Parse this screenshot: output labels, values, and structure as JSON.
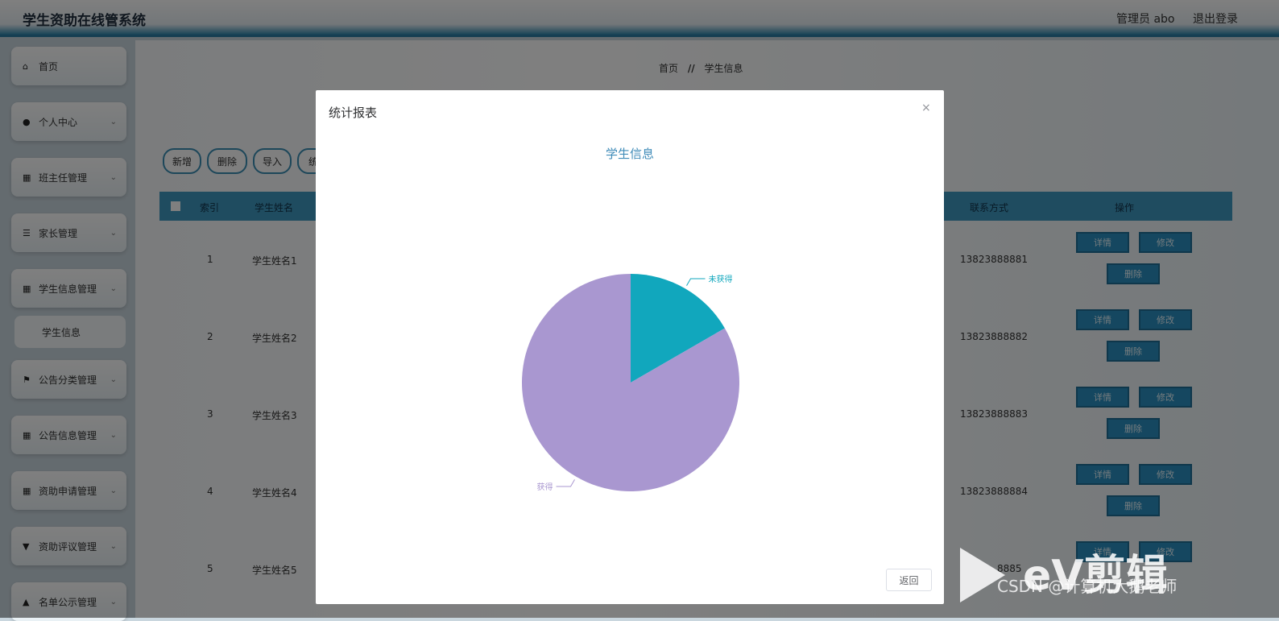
{
  "app": {
    "title": "学生资助在线管系统",
    "admin_label": "管理员 abo",
    "logout_label": "退出登录"
  },
  "sidebar": {
    "items": [
      {
        "label": "首页",
        "icon": "home-icon"
      },
      {
        "label": "个人中心",
        "icon": "user-icon"
      },
      {
        "label": "班主任管理",
        "icon": "grid-icon"
      },
      {
        "label": "家长管理",
        "icon": "list-icon"
      },
      {
        "label": "学生信息管理",
        "icon": "grid-icon"
      },
      {
        "label": "公告分类管理",
        "icon": "flag-icon"
      },
      {
        "label": "公告信息管理",
        "icon": "grid-icon"
      },
      {
        "label": "资助申请管理",
        "icon": "grid-icon"
      },
      {
        "label": "资助评议管理",
        "icon": "cup-icon"
      },
      {
        "label": "名单公示管理",
        "icon": "thumb-icon"
      }
    ],
    "sub_item_label": "学生信息"
  },
  "breadcrumb": {
    "home": "首页",
    "separator": "//",
    "current": "学生信息"
  },
  "toolbar": {
    "add": "新增",
    "delete": "删除",
    "import": "导入",
    "stats": "统"
  },
  "table": {
    "headers": {
      "index": "索引",
      "name": "学生姓名",
      "contact": "联系方式",
      "actions": "操作"
    },
    "rows": [
      {
        "index": "1",
        "name": "学生姓名1",
        "contact": "13823888881"
      },
      {
        "index": "2",
        "name": "学生姓名2",
        "contact": "13823888882"
      },
      {
        "index": "3",
        "name": "学生姓名3",
        "contact": "13823888883"
      },
      {
        "index": "4",
        "name": "学生姓名4",
        "contact": "13823888884"
      },
      {
        "index": "5",
        "name": "学生姓名5",
        "contact": "8885"
      }
    ],
    "detail_label": "详情",
    "edit_label": "修改",
    "delete_label": "删除"
  },
  "modal": {
    "title": "统计报表",
    "close": "×",
    "return_label": "返回"
  },
  "chart_data": {
    "type": "pie",
    "title": "学生信息",
    "slices": [
      {
        "label": "未获得",
        "value": 1,
        "color": "#11a7bd"
      },
      {
        "label": "获得",
        "value": 5,
        "color": "#a997d0"
      }
    ]
  },
  "watermark": {
    "brand": "eV剪辑",
    "text": "CSDN @计算机大鹅老师"
  }
}
